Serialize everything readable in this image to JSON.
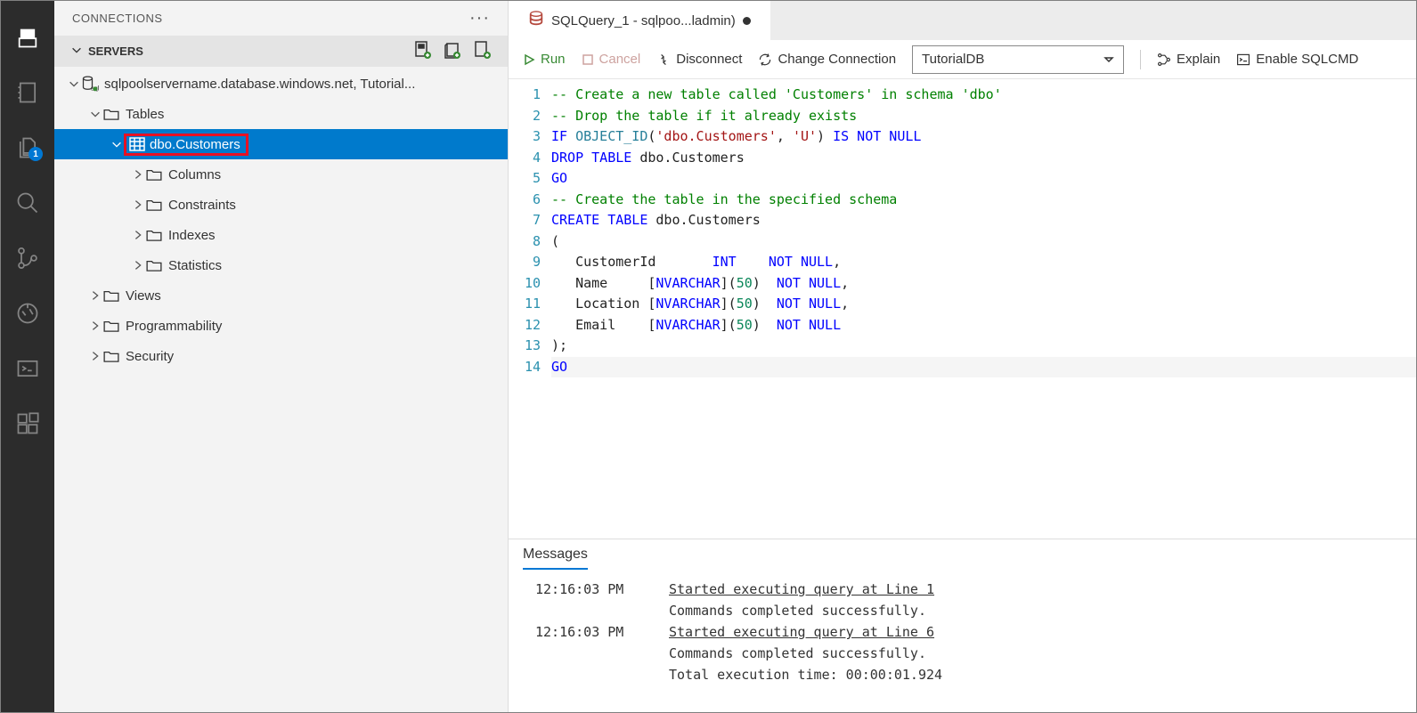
{
  "explorer_badge": "1",
  "panel": {
    "connections": "CONNECTIONS",
    "servers": "SERVERS"
  },
  "tree": {
    "server": "sqlpoolservername.database.windows.net, Tutorial...",
    "tables": "Tables",
    "table": "dbo.Customers",
    "columns": "Columns",
    "constraints": "Constraints",
    "indexes": "Indexes",
    "statistics": "Statistics",
    "views": "Views",
    "programmability": "Programmability",
    "security": "Security"
  },
  "tab": {
    "label": "SQLQuery_1 - sqlpoo...ladmin)"
  },
  "toolbar": {
    "run": "Run",
    "cancel": "Cancel",
    "disconnect": "Disconnect",
    "change": "Change Connection",
    "database": "TutorialDB",
    "explain": "Explain",
    "sqlcmd": "Enable SQLCMD"
  },
  "code": {
    "l1": "-- Create a new table called 'Customers' in schema 'dbo'",
    "l2": "-- Drop the table if it already exists",
    "l3a": "IF",
    "l3b": "OBJECT_ID",
    "l3c": "(",
    "l3d": "'dbo.Customers'",
    "l3e": ", ",
    "l3f": "'U'",
    "l3g": ") ",
    "l3h": "IS NOT NULL",
    "l4a": "DROP TABLE",
    "l4b": " dbo.Customers",
    "l5": "GO",
    "l6": "-- Create the table in the specified schema",
    "l7a": "CREATE TABLE",
    "l7b": " dbo.Customers",
    "l8": "(",
    "l9a": "   CustomerId       ",
    "l9b": "INT",
    "l9c": "    ",
    "l9d": "NOT NULL",
    "l9e": ",",
    "l10a": "   Name     [",
    "l10b": "NVARCHAR",
    "l10c": "](",
    "l10d": "50",
    "l10e": ")  ",
    "l10f": "NOT NULL",
    "l10g": ",",
    "l11a": "   Location [",
    "l11b": "NVARCHAR",
    "l11c": "](",
    "l11d": "50",
    "l11e": ")  ",
    "l11f": "NOT NULL",
    "l11g": ",",
    "l12a": "   Email    [",
    "l12b": "NVARCHAR",
    "l12c": "](",
    "l12d": "50",
    "l12e": ")  ",
    "l12f": "NOT NULL",
    "l13": ");",
    "l14": "GO"
  },
  "lines": [
    "1",
    "2",
    "3",
    "4",
    "5",
    "6",
    "7",
    "8",
    "9",
    "10",
    "11",
    "12",
    "13",
    "14"
  ],
  "messages": {
    "title": "Messages",
    "t1": "12:16:03 PM",
    "m1a": "Started executing query at Line 1",
    "m1b": "Commands completed successfully.",
    "t2": "12:16:03 PM",
    "m2a": "Started executing query at Line 6",
    "m2b": "Commands completed successfully.",
    "m2c": "Total execution time: 00:00:01.924"
  }
}
